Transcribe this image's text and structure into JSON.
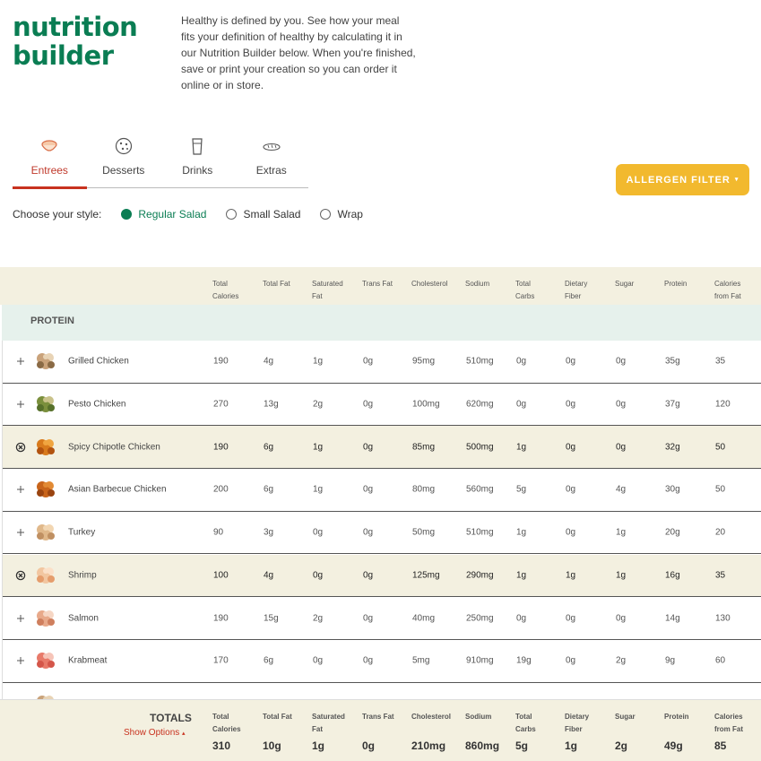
{
  "brand": {
    "line1": "nutrition",
    "line2": "builder"
  },
  "intro": "Healthy is defined by you. See how your meal fits your definition of healthy by calculating it in our Nutrition Builder below. When you're finished, save or print your creation so you can order it online or in store.",
  "tabs": [
    {
      "label": "Entrees",
      "icon": "bowl-icon",
      "active": true
    },
    {
      "label": "Desserts",
      "icon": "cookie-icon",
      "active": false
    },
    {
      "label": "Drinks",
      "icon": "cup-icon",
      "active": false
    },
    {
      "label": "Extras",
      "icon": "bread-icon",
      "active": false
    }
  ],
  "allergen": {
    "label": "ALLERGEN FILTER",
    "caret": "▾"
  },
  "style": {
    "label": "Choose your style:",
    "options": [
      {
        "label": "Regular Salad",
        "selected": true
      },
      {
        "label": "Small Salad",
        "selected": false
      },
      {
        "label": "Wrap",
        "selected": false
      }
    ]
  },
  "columns": [
    [
      "Total",
      "Calories"
    ],
    [
      "Total Fat",
      ""
    ],
    [
      "Saturated",
      "Fat"
    ],
    [
      "Trans Fat",
      ""
    ],
    [
      "Cholesterol",
      ""
    ],
    [
      "Sodium",
      ""
    ],
    [
      "Total",
      "Carbs"
    ],
    [
      "Dietary",
      "Fiber"
    ],
    [
      "Sugar",
      ""
    ],
    [
      "Protein",
      ""
    ],
    [
      "Calories",
      "from Fat"
    ]
  ],
  "section": "PROTEIN",
  "items": [
    {
      "name": "Grilled Chicken",
      "selected": false,
      "icon": "grilled-chicken-icon",
      "values": [
        "190",
        "4g",
        "1g",
        "0g",
        "95mg",
        "510mg",
        "0g",
        "0g",
        "0g",
        "35g",
        "35"
      ]
    },
    {
      "name": "Pesto Chicken",
      "selected": false,
      "icon": "pesto-chicken-icon",
      "values": [
        "270",
        "13g",
        "2g",
        "0g",
        "100mg",
        "620mg",
        "0g",
        "0g",
        "0g",
        "37g",
        "120"
      ]
    },
    {
      "name": "Spicy Chipotle Chicken",
      "selected": true,
      "icon": "spicy-chipotle-chicken-icon",
      "values": [
        "190",
        "6g",
        "1g",
        "0g",
        "85mg",
        "500mg",
        "1g",
        "0g",
        "0g",
        "32g",
        "50"
      ]
    },
    {
      "name": "Asian Barbecue Chicken",
      "selected": false,
      "icon": "asian-bbq-chicken-icon",
      "values": [
        "200",
        "6g",
        "1g",
        "0g",
        "80mg",
        "560mg",
        "5g",
        "0g",
        "4g",
        "30g",
        "50"
      ]
    },
    {
      "name": "Turkey",
      "selected": false,
      "icon": "turkey-icon",
      "values": [
        "90",
        "3g",
        "0g",
        "0g",
        "50mg",
        "510mg",
        "1g",
        "0g",
        "1g",
        "20g",
        "20"
      ]
    },
    {
      "name": "Shrimp",
      "selected": true,
      "icon": "shrimp-icon",
      "values": [
        "100",
        "4g",
        "0g",
        "0g",
        "125mg",
        "290mg",
        "1g",
        "1g",
        "1g",
        "16g",
        "35"
      ]
    },
    {
      "name": "Salmon",
      "selected": false,
      "icon": "salmon-icon",
      "values": [
        "190",
        "15g",
        "2g",
        "0g",
        "40mg",
        "250mg",
        "0g",
        "0g",
        "0g",
        "14g",
        "130"
      ]
    },
    {
      "name": "Krabmeat",
      "selected": false,
      "icon": "krabmeat-icon",
      "values": [
        "170",
        "6g",
        "0g",
        "0g",
        "5mg",
        "910mg",
        "19g",
        "0g",
        "2g",
        "9g",
        "60"
      ]
    }
  ],
  "totals": {
    "label": "TOTALS",
    "show_options": "Show Options",
    "show_options_icon": "▴",
    "values": [
      "310",
      "10g",
      "1g",
      "0g",
      "210mg",
      "860mg",
      "5g",
      "1g",
      "2g",
      "49g",
      "85"
    ]
  }
}
